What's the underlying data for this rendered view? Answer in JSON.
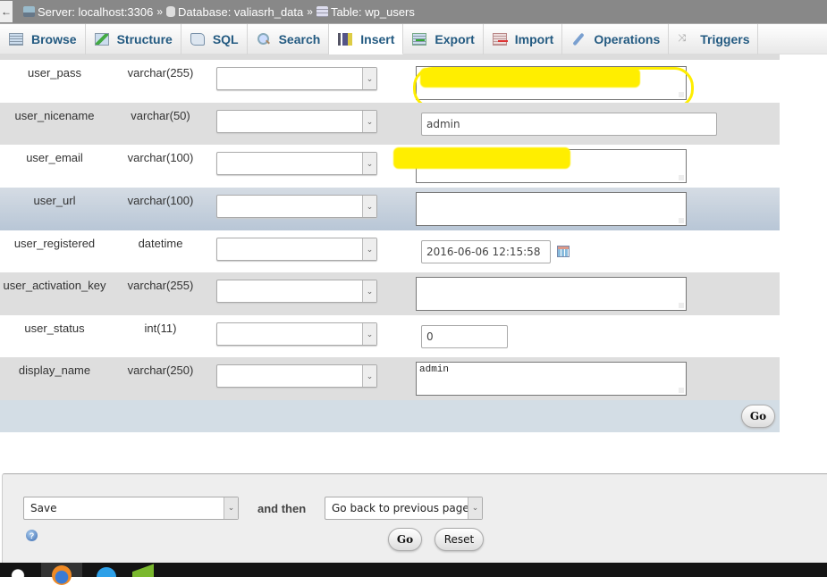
{
  "breadcrumb": {
    "back_label": "←",
    "server": "Server: localhost:3306",
    "database": "Database: valiasrh_data",
    "table": "Table: wp_users",
    "separator": "»"
  },
  "tabs": [
    {
      "label": "Browse",
      "icon": "browse-icon",
      "active": false
    },
    {
      "label": "Structure",
      "icon": "structure-icon",
      "active": false
    },
    {
      "label": "SQL",
      "icon": "sql-icon",
      "active": false
    },
    {
      "label": "Search",
      "icon": "search-icon",
      "active": false
    },
    {
      "label": "Insert",
      "icon": "insert-icon",
      "active": true
    },
    {
      "label": "Export",
      "icon": "export-icon",
      "active": false
    },
    {
      "label": "Import",
      "icon": "import-icon",
      "active": false
    },
    {
      "label": "Operations",
      "icon": "wrench-icon",
      "active": false
    },
    {
      "label": "Triggers",
      "icon": "triggers-icon",
      "active": false
    }
  ],
  "rows": [
    {
      "column": "user_pass",
      "type": "varchar(255)",
      "function": "",
      "value": "",
      "value_redacted": true,
      "input": "textarea"
    },
    {
      "column": "user_nicename",
      "type": "varchar(50)",
      "function": "",
      "value": "admin",
      "input": "text"
    },
    {
      "column": "user_email",
      "type": "varchar(100)",
      "function": "",
      "value": "",
      "value_redacted": true,
      "input": "textarea"
    },
    {
      "column": "user_url",
      "type": "varchar(100)",
      "function": "",
      "value": "",
      "input": "textarea"
    },
    {
      "column": "user_registered",
      "type": "datetime",
      "function": "",
      "value": "2016-06-06 12:15:58",
      "input": "datetime"
    },
    {
      "column": "user_activation_key",
      "type": "varchar(255)",
      "function": "",
      "value": "",
      "input": "textarea"
    },
    {
      "column": "user_status",
      "type": "int(11)",
      "function": "",
      "value": "0",
      "input": "text"
    },
    {
      "column": "display_name",
      "type": "varchar(250)",
      "function": "",
      "value": "admin",
      "input": "textarea"
    }
  ],
  "form_go_label": "Go",
  "bottom": {
    "action_select": "Save",
    "and_then_label": "and then",
    "after_select": "Go back to previous page",
    "go_label": "Go",
    "reset_label": "Reset",
    "help_icon": "?"
  },
  "colors": {
    "tab_text": "#235a81",
    "highlight": "#ffee00",
    "row_gray": "#dedede",
    "row_hover": "#c6d1dc"
  }
}
